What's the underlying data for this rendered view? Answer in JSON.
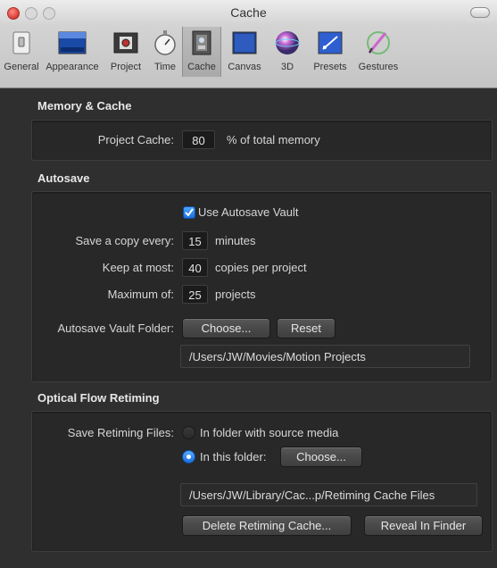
{
  "window": {
    "title": "Cache"
  },
  "toolbar": {
    "items": [
      {
        "label": "General",
        "icon": "general-switch-icon"
      },
      {
        "label": "Appearance",
        "icon": "appearance-icon"
      },
      {
        "label": "Project",
        "icon": "project-film-icon"
      },
      {
        "label": "Time",
        "icon": "stopwatch-icon"
      },
      {
        "label": "Cache",
        "icon": "cache-film-icon"
      },
      {
        "label": "Canvas",
        "icon": "canvas-icon"
      },
      {
        "label": "3D",
        "icon": "sphere-3d-icon"
      },
      {
        "label": "Presets",
        "icon": "presets-icon"
      },
      {
        "label": "Gestures",
        "icon": "gestures-pen-icon"
      }
    ],
    "active": "Cache"
  },
  "memory": {
    "title": "Memory & Cache",
    "project_cache_label": "Project Cache:",
    "project_cache_value": "80",
    "project_cache_suffix": "% of total memory"
  },
  "autosave": {
    "title": "Autosave",
    "use_vault_label": "Use Autosave Vault",
    "use_vault_checked": true,
    "save_copy_label": "Save a copy every:",
    "save_copy_value": "15",
    "save_copy_suffix": "minutes",
    "keep_label": "Keep at most:",
    "keep_value": "40",
    "keep_suffix": "copies per project",
    "max_label": "Maximum of:",
    "max_value": "25",
    "max_suffix": "projects",
    "folder_label": "Autosave Vault Folder:",
    "choose_button": "Choose...",
    "reset_button": "Reset",
    "folder_path": "/Users/JW/Movies/Motion Projects"
  },
  "optical_flow": {
    "title": "Optical Flow Retiming",
    "save_files_label": "Save Retiming Files:",
    "option_source": "In folder with source media",
    "option_this_folder": "In this folder:",
    "selected": "In this folder:",
    "choose_button": "Choose...",
    "folder_path": "/Users/JW/Library/Cac...p/Retiming Cache Files",
    "delete_button": "Delete Retiming Cache...",
    "reveal_button": "Reveal In Finder"
  },
  "colors": {
    "accent": "#2a84ff",
    "background": "#2f2f2f",
    "panel": "#282828"
  }
}
